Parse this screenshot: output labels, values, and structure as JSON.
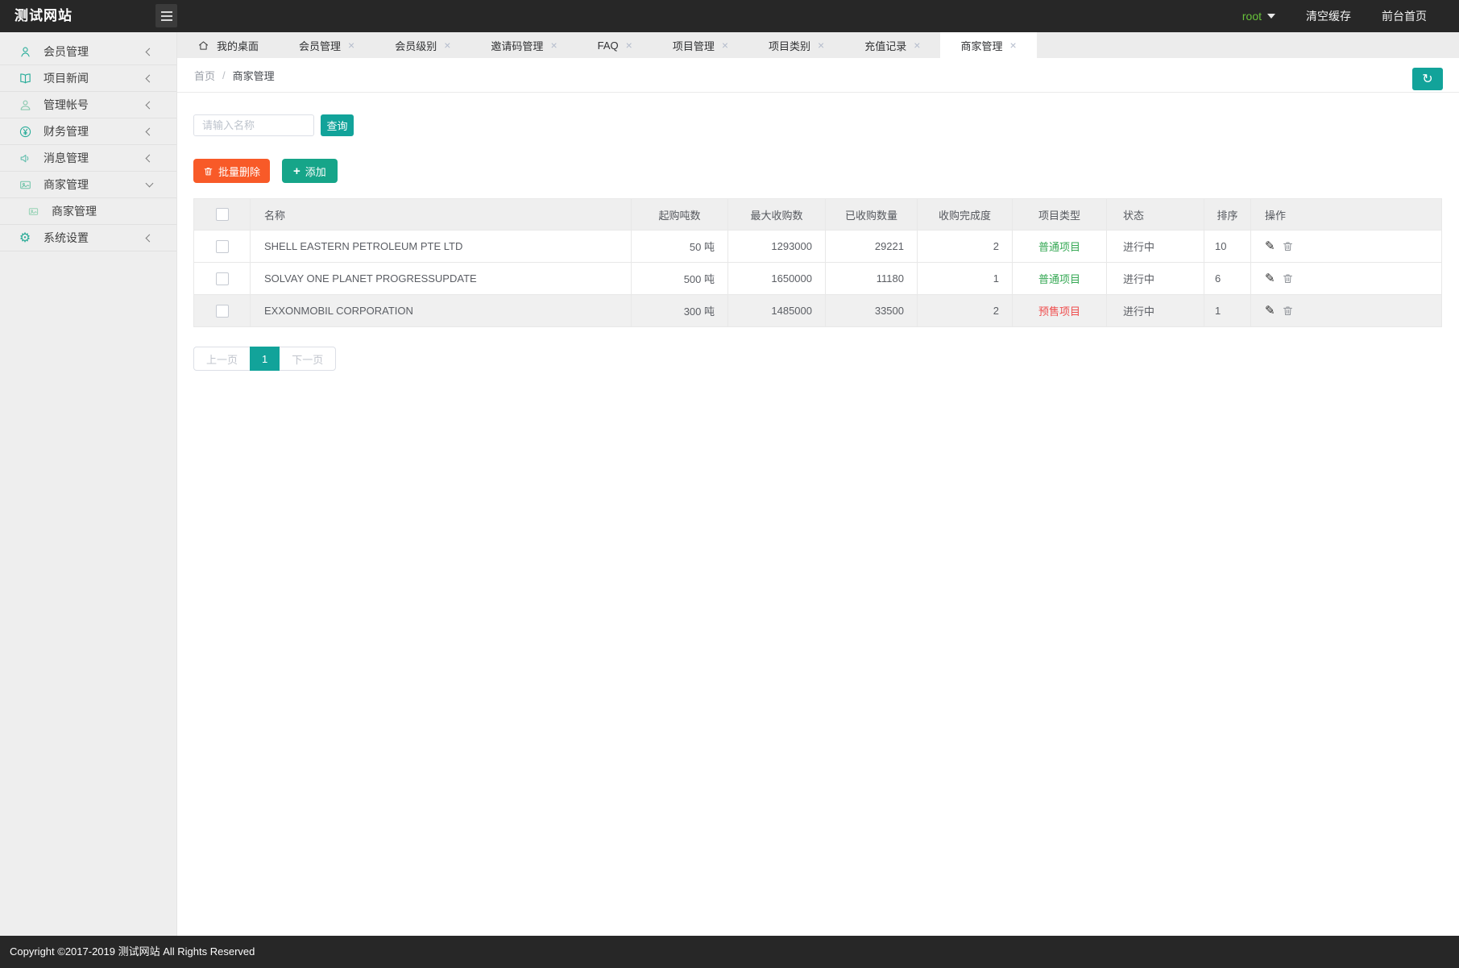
{
  "topbar": {
    "logo": "测试网站",
    "user": "root",
    "clear_cache": "清空缓存",
    "front_home": "前台首页"
  },
  "sidebar": {
    "items": [
      {
        "label": "会员管理"
      },
      {
        "label": "项目新闻"
      },
      {
        "label": "管理帐号"
      },
      {
        "label": "财务管理"
      },
      {
        "label": "消息管理"
      },
      {
        "label": "商家管理",
        "expanded": true,
        "children": [
          {
            "label": "商家管理",
            "active": true
          }
        ]
      },
      {
        "label": "系统设置"
      }
    ]
  },
  "tabs": [
    {
      "label": "我的桌面",
      "closable": false
    },
    {
      "label": "会员管理",
      "closable": true
    },
    {
      "label": "会员级别",
      "closable": true
    },
    {
      "label": "邀请码管理",
      "closable": true
    },
    {
      "label": "FAQ",
      "closable": true
    },
    {
      "label": "项目管理",
      "closable": true
    },
    {
      "label": "项目类别",
      "closable": true
    },
    {
      "label": "充值记录",
      "closable": true
    },
    {
      "label": "商家管理",
      "closable": true,
      "active": true
    }
  ],
  "breadcrumb": {
    "home": "首页",
    "separator": "/",
    "current": "商家管理"
  },
  "search": {
    "placeholder": "请输入名称",
    "query_label": "查询"
  },
  "actions": {
    "batch_delete": "批量删除",
    "add": "添加"
  },
  "table": {
    "headers": [
      "名称",
      "起购吨数",
      "最大收购数",
      "已收购数量",
      "收购完成度",
      "项目类型",
      "状态",
      "排序",
      "操作"
    ],
    "rows": [
      {
        "name": "SHELL EASTERN PETROLEUM PTE LTD",
        "min_tons": "50 吨",
        "max_acquire": "1293000",
        "acquired": "29221",
        "completion": "2",
        "type": "普通项目",
        "type_color": "green",
        "status": "进行中",
        "sort": "10"
      },
      {
        "name": "SOLVAY ONE PLANET PROGRESSUPDATE",
        "min_tons": "500 吨",
        "max_acquire": "1650000",
        "acquired": "11180",
        "completion": "1",
        "type": "普通项目",
        "type_color": "green",
        "status": "进行中",
        "sort": "6"
      },
      {
        "name": "EXXONMOBIL CORPORATION",
        "min_tons": "300 吨",
        "max_acquire": "1485000",
        "acquired": "33500",
        "completion": "2",
        "type": "预售项目",
        "type_color": "red",
        "status": "进行中",
        "sort": "1"
      }
    ]
  },
  "pagination": {
    "prev": "上一页",
    "current": "1",
    "next": "下一页"
  },
  "footer": {
    "copyright": "Copyright ©2017-2019 测试网站 All Rights Reserved"
  },
  "icons": {
    "close": "×",
    "plus": "+",
    "refresh": "↻",
    "pencil": "✎",
    "gear": "⚙"
  },
  "colors": {
    "accent_teal": "#12a39a",
    "add_green": "#16a589",
    "delete_orange": "#f85a28",
    "type_green": "#35a854",
    "type_red": "#ef4d4d",
    "user_green": "#67c23a",
    "dark_bar": "#272727",
    "sidebar_bg": "#eeeeee"
  }
}
